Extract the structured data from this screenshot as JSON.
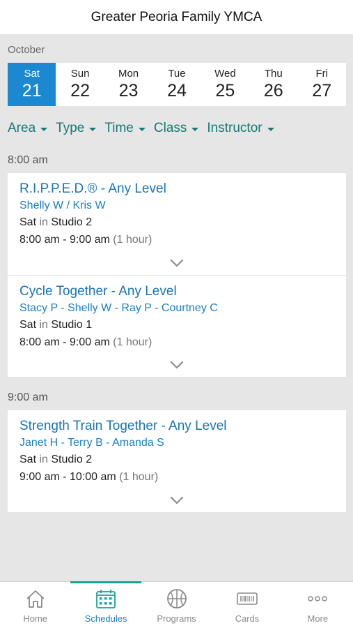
{
  "header": {
    "title": "Greater Peoria Family YMCA"
  },
  "calendar": {
    "month": "October",
    "days": [
      {
        "name": "Sat",
        "num": "21",
        "selected": true
      },
      {
        "name": "Sun",
        "num": "22"
      },
      {
        "name": "Mon",
        "num": "23"
      },
      {
        "name": "Tue",
        "num": "24"
      },
      {
        "name": "Wed",
        "num": "25"
      },
      {
        "name": "Thu",
        "num": "26"
      },
      {
        "name": "Fri",
        "num": "27"
      }
    ]
  },
  "filters": [
    "Area",
    "Type",
    "Time",
    "Class",
    "Instructor"
  ],
  "groups": [
    {
      "time": "8:00 am",
      "sessions": [
        {
          "title": "R.I.P.P.E.D.® - Any Level",
          "instructors": "Shelly W / Kris W",
          "day": "Sat",
          "in_word": "in",
          "room": "Studio 2",
          "time_range": "8:00 am - 9:00 am",
          "duration": "(1 hour)"
        },
        {
          "title": "Cycle Together - Any Level",
          "instructors": "Stacy P - Shelly W - Ray P - Courtney C",
          "day": "Sat",
          "in_word": "in",
          "room": "Studio 1",
          "time_range": "8:00 am - 9:00 am",
          "duration": "(1 hour)"
        }
      ]
    },
    {
      "time": "9:00 am",
      "sessions": [
        {
          "title": "Strength Train Together - Any Level",
          "instructors": "Janet H - Terry B - Amanda S",
          "day": "Sat",
          "in_word": "in",
          "room": "Studio 2",
          "time_range": "9:00 am - 10:00 am",
          "duration": "(1 hour)"
        }
      ]
    }
  ],
  "tabbar": {
    "tabs": [
      {
        "label": "Home",
        "icon": "home-icon"
      },
      {
        "label": "Schedules",
        "icon": "calendar-icon",
        "active": true
      },
      {
        "label": "Programs",
        "icon": "basketball-icon"
      },
      {
        "label": "Cards",
        "icon": "barcode-card-icon"
      },
      {
        "label": "More",
        "icon": "more-dots-icon"
      }
    ]
  },
  "colors": {
    "accent": "#1b88d1",
    "filter_teal": "#157a72",
    "tab_active": "#1aa294",
    "link_blue": "#1a73b5"
  }
}
